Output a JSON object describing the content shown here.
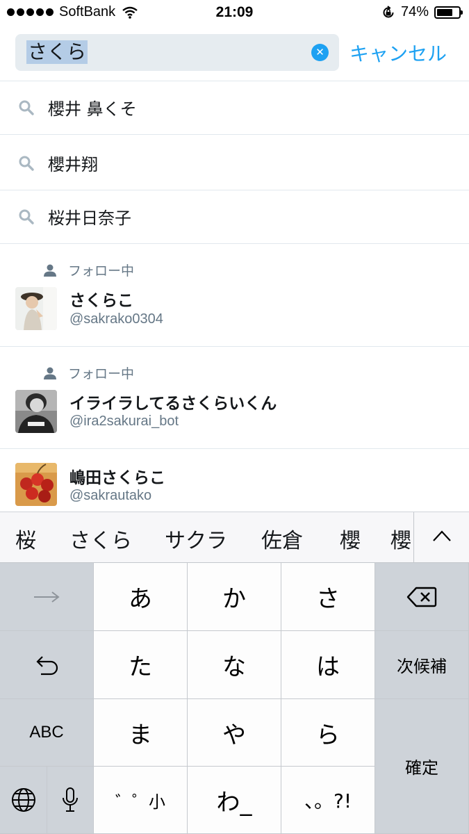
{
  "status_bar": {
    "carrier": "SoftBank",
    "time": "21:09",
    "battery_percent": "74%",
    "battery_level": 0.74,
    "icons": [
      "signal-dots-icon",
      "wifi-icon",
      "orientation-lock-icon",
      "battery-icon"
    ]
  },
  "search": {
    "query": "さくら",
    "clear_icon": "clear-circle-icon",
    "cancel_label": "キャンセル"
  },
  "suggestions": [
    {
      "text": "櫻井 鼻くそ",
      "icon": "search-icon"
    },
    {
      "text": "櫻井翔",
      "icon": "search-icon"
    },
    {
      "text": "桜井日奈子",
      "icon": "search-icon"
    }
  ],
  "users": [
    {
      "context": "フォロー中",
      "context_icon": "person-icon",
      "name": "さくらこ",
      "handle": "@sakrako0304"
    },
    {
      "context": "フォロー中",
      "context_icon": "person-icon",
      "name": "イライラしてるさくらいくん",
      "handle": "@ira2sakurai_bot"
    },
    {
      "context": "",
      "name": "嶋田さくらこ",
      "handle": "@sakrautako"
    }
  ],
  "candidates": {
    "items": [
      "桜",
      "さくら",
      "サクラ",
      "佐倉",
      "櫻",
      "櫻"
    ],
    "expand_icon": "chevron-up-icon"
  },
  "keyboard": {
    "row1": {
      "left_icon": "arrow-right-icon",
      "keys": [
        "あ",
        "か",
        "さ"
      ],
      "right_icon": "delete-icon"
    },
    "row2": {
      "left_icon": "undo-icon",
      "keys": [
        "た",
        "な",
        "は"
      ],
      "right": "次候補"
    },
    "row3": {
      "left": "ABC",
      "keys": [
        "ま",
        "や",
        "ら"
      ],
      "right": "確定"
    },
    "row4": {
      "globe_icon": "globe-icon",
      "mic_icon": "microphone-icon",
      "keys": [
        "゛゜小",
        "わ_",
        "、。?!"
      ]
    }
  },
  "colors": {
    "accent": "#1da1f2",
    "secondary_text": "#657786",
    "divider": "#e1e8ed",
    "keyboard_bg": "#d1d5db",
    "key_bg": "#fdfdfd",
    "func_key_bg": "#ced3d9"
  }
}
